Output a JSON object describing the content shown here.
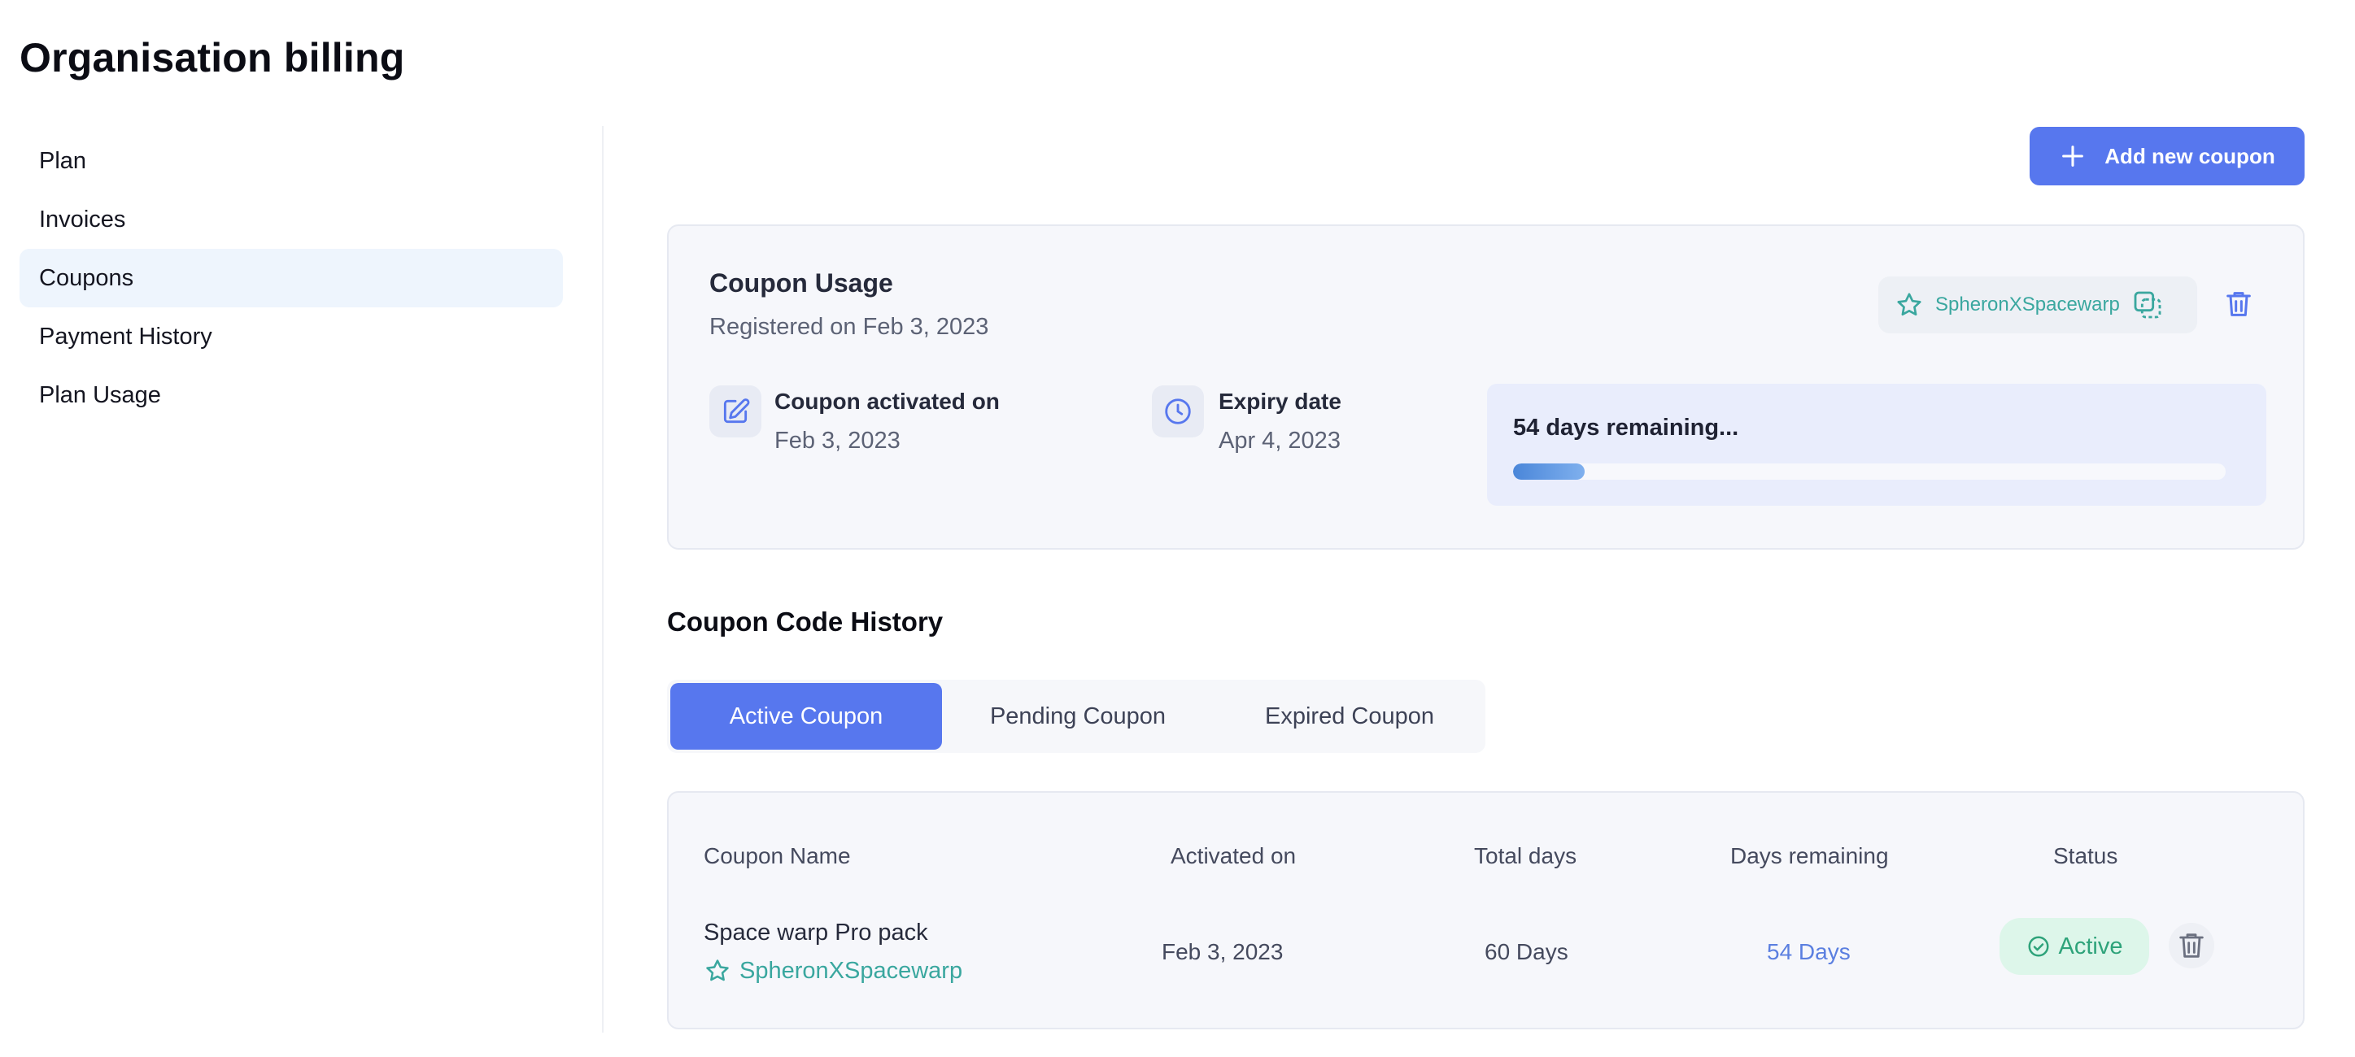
{
  "page": {
    "title": "Organisation billing"
  },
  "sidebar": {
    "items": [
      {
        "label": "Plan"
      },
      {
        "label": "Invoices"
      },
      {
        "label": "Coupons",
        "active": true
      },
      {
        "label": "Payment History"
      },
      {
        "label": "Plan Usage"
      }
    ]
  },
  "toolbar": {
    "add_coupon_label": "Add new coupon",
    "add_icon": "plus-icon"
  },
  "coupon_usage": {
    "title": "Coupon Usage",
    "registered": "Registered on Feb 3, 2023",
    "code": "SpheronXSpacewarp",
    "code_icon": "star-icon",
    "copy_icon": "copy-icon",
    "delete_icon": "trash-icon",
    "activated": {
      "label": "Coupon activated on",
      "value": "Feb 3, 2023",
      "icon": "edit-icon"
    },
    "expiry": {
      "label": "Expiry date",
      "value": "Apr 4, 2023",
      "icon": "clock-icon"
    },
    "remaining": {
      "text": "54 days remaining...",
      "progress": 0.1
    }
  },
  "history": {
    "title": "Coupon Code History",
    "tabs": [
      {
        "label": "Active Coupon",
        "active": true
      },
      {
        "label": "Pending Coupon"
      },
      {
        "label": "Expired Coupon"
      }
    ],
    "columns": [
      "Coupon Name",
      "Activated on",
      "Total days",
      "Days remaining",
      "Status"
    ],
    "rows": [
      {
        "name": "Space warp Pro pack",
        "code": "SpheronXSpacewarp",
        "activated_on": "Feb 3, 2023",
        "total_days": "60 Days",
        "days_remaining": "54 Days",
        "status": "Active"
      }
    ]
  },
  "colors": {
    "accent": "#5777ee",
    "teal": "#3aa79f",
    "success": "#2ea37a",
    "success_bg": "#ddf6ea",
    "days_remaining": "#5b7fe0"
  }
}
